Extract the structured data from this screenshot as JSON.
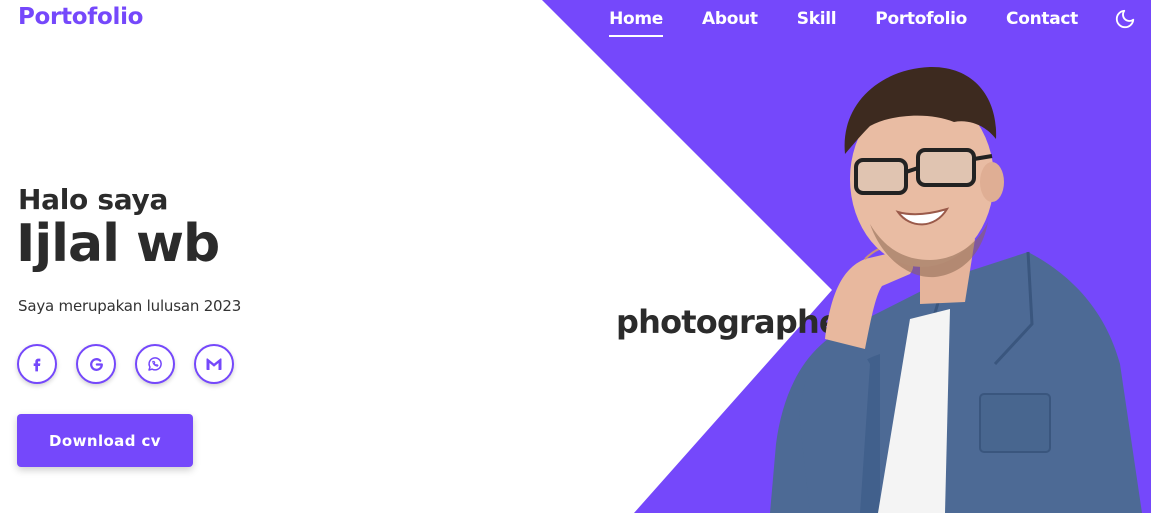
{
  "colors": {
    "accent": "#7548fb",
    "text_dark": "#2b2b2b",
    "white": "#ffffff"
  },
  "header": {
    "logo": "Portofolio",
    "nav": [
      {
        "label": "Home",
        "active": true
      },
      {
        "label": "About",
        "active": false
      },
      {
        "label": "Skill",
        "active": false
      },
      {
        "label": "Portofolio",
        "active": false
      },
      {
        "label": "Contact",
        "active": false
      }
    ],
    "theme_icon": "moon-icon"
  },
  "hero": {
    "greeting": "Halo saya",
    "name": "Ijlal wb",
    "subtitle": "Saya merupakan lulusan 2023",
    "socials": [
      {
        "icon": "facebook-icon"
      },
      {
        "icon": "google-icon"
      },
      {
        "icon": "whatsapp-icon"
      },
      {
        "icon": "gmail-icon"
      }
    ],
    "download_label": "Download cv",
    "role_text": "photographer"
  }
}
